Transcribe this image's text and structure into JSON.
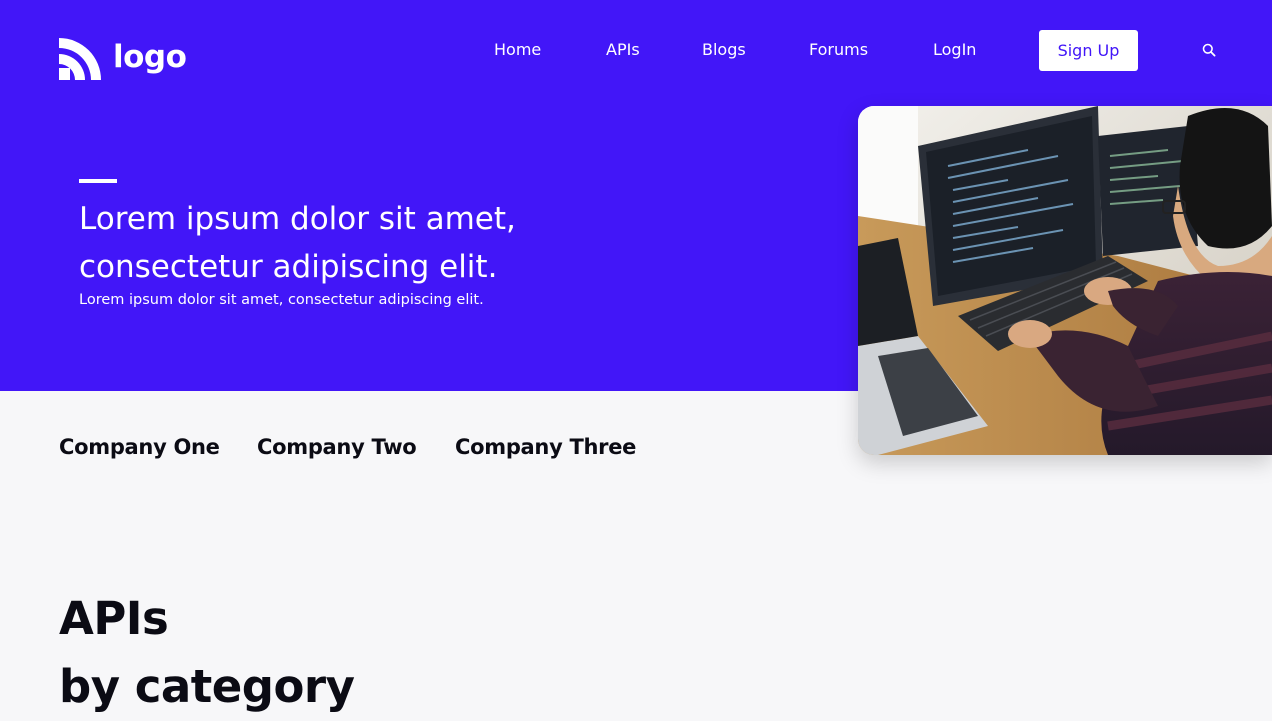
{
  "header": {
    "logo_text": "logo",
    "nav": [
      "Home",
      "APIs",
      "Blogs",
      "Forums",
      "LogIn"
    ],
    "signup_label": "Sign Up",
    "search_icon": "search-icon"
  },
  "hero": {
    "title_line1": "Lorem ipsum dolor sit amet,",
    "title_line2": "consectetur adipiscing elit.",
    "subtitle": "Lorem ipsum dolor sit amet, consectetur adipiscing elit.",
    "image": "developer-at-computers-photo"
  },
  "companies": [
    "Company One",
    "Company Two",
    "Company Three"
  ],
  "section": {
    "title_line1": "APIs",
    "title_line2": "by category"
  },
  "colors": {
    "brand": "#4216f8",
    "page_bg": "#f7f7f9",
    "text_dark": "#0b0b14",
    "white": "#ffffff"
  }
}
